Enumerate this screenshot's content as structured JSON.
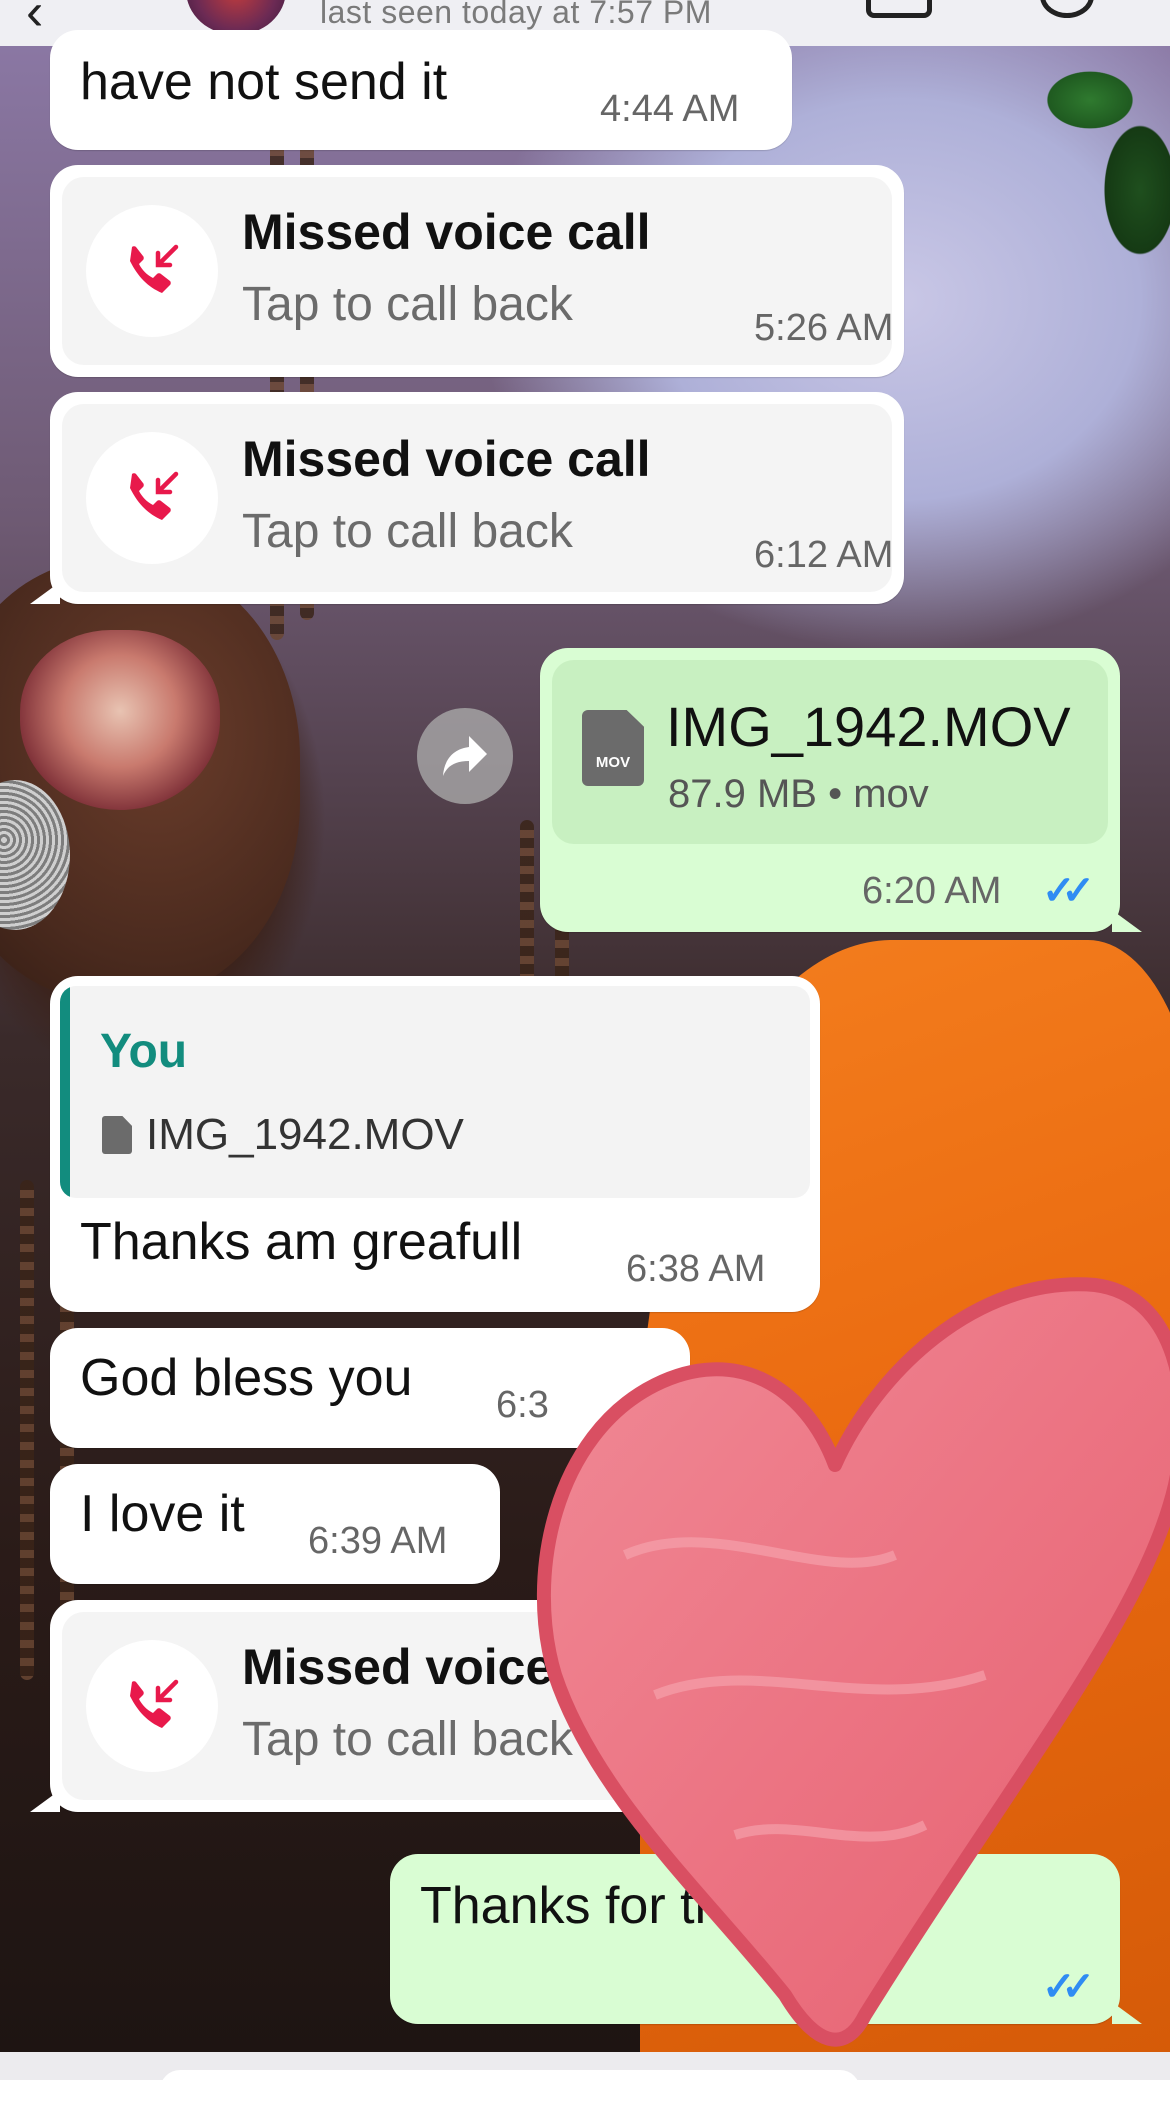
{
  "header": {
    "last_seen": "last seen today at 7:57 PM",
    "back_icon": "chevron-left-icon",
    "video_icon": "video-camera-icon",
    "call_icon": "phone-icon"
  },
  "colors": {
    "incoming_bubble": "#ffffff",
    "outgoing_bubble": "#d9fdd3",
    "read_ticks": "#2f8cf3",
    "missed_call_icon": "#e8194b",
    "quote_accent": "#128c7e"
  },
  "messages": [
    {
      "type": "text",
      "direction": "in",
      "text": "have not send it",
      "time": "4:44 AM"
    },
    {
      "type": "missed_call",
      "direction": "in",
      "title": "Missed voice call",
      "subtitle": "Tap to call back",
      "time": "5:26 AM"
    },
    {
      "type": "missed_call",
      "direction": "in",
      "title": "Missed voice call",
      "subtitle": "Tap to call back",
      "time": "6:12 AM"
    },
    {
      "type": "file",
      "direction": "out",
      "icon_label": "MOV",
      "filename": "IMG_1942.MOV",
      "meta": "87.9 MB • mov",
      "time": "6:20 AM",
      "status": "read"
    },
    {
      "type": "reply",
      "direction": "in",
      "quote_author": "You",
      "quote_file": "IMG_1942.MOV",
      "text": "Thanks am greafull",
      "time": "6:38 AM"
    },
    {
      "type": "text",
      "direction": "in",
      "text": "God bless you",
      "time": "6:3"
    },
    {
      "type": "text",
      "direction": "in",
      "text": "I love it",
      "time": "6:39 AM"
    },
    {
      "type": "missed_call",
      "direction": "in",
      "title": "Missed voice",
      "subtitle": "Tap to call back",
      "time": ""
    },
    {
      "type": "text",
      "direction": "out",
      "text": "Thanks for tru",
      "time": "",
      "status": "read"
    }
  ],
  "overlay": {
    "sticker": "heart-sticker"
  }
}
